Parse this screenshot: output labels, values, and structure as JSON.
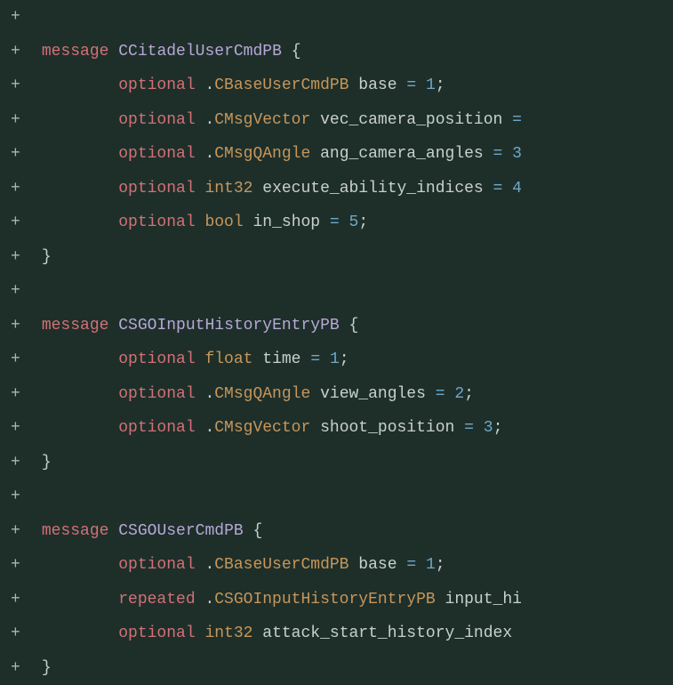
{
  "lines": [
    {
      "marker": "+",
      "tokens": []
    },
    {
      "marker": "+",
      "tokens": [
        {
          "cls": "indent",
          "t": " "
        },
        {
          "cls": "kw-message",
          "t": "message"
        },
        {
          "cls": "ident",
          "t": " "
        },
        {
          "cls": "msg-name",
          "t": "CCitadelUserCmdPB"
        },
        {
          "cls": "ident",
          "t": " "
        },
        {
          "cls": "brace",
          "t": "{"
        }
      ]
    },
    {
      "marker": "+",
      "tokens": [
        {
          "cls": "indent",
          "t": "         "
        },
        {
          "cls": "kw-optional",
          "t": "optional"
        },
        {
          "cls": "ident",
          "t": " ."
        },
        {
          "cls": "type-user",
          "t": "CBaseUserCmdPB"
        },
        {
          "cls": "ident",
          "t": " "
        },
        {
          "cls": "field",
          "t": "base"
        },
        {
          "cls": "ident",
          "t": " "
        },
        {
          "cls": "op",
          "t": "="
        },
        {
          "cls": "ident",
          "t": " "
        },
        {
          "cls": "num",
          "t": "1"
        },
        {
          "cls": "punct",
          "t": ";"
        }
      ]
    },
    {
      "marker": "+",
      "tokens": [
        {
          "cls": "indent",
          "t": "         "
        },
        {
          "cls": "kw-optional",
          "t": "optional"
        },
        {
          "cls": "ident",
          "t": " ."
        },
        {
          "cls": "type-user",
          "t": "CMsgVector"
        },
        {
          "cls": "ident",
          "t": " "
        },
        {
          "cls": "field",
          "t": "vec_camera_position"
        },
        {
          "cls": "ident",
          "t": " "
        },
        {
          "cls": "op",
          "t": "="
        }
      ]
    },
    {
      "marker": "+",
      "tokens": [
        {
          "cls": "indent",
          "t": "         "
        },
        {
          "cls": "kw-optional",
          "t": "optional"
        },
        {
          "cls": "ident",
          "t": " ."
        },
        {
          "cls": "type-user",
          "t": "CMsgQAngle"
        },
        {
          "cls": "ident",
          "t": " "
        },
        {
          "cls": "field",
          "t": "ang_camera_angles"
        },
        {
          "cls": "ident",
          "t": " "
        },
        {
          "cls": "op",
          "t": "="
        },
        {
          "cls": "ident",
          "t": " "
        },
        {
          "cls": "num",
          "t": "3"
        }
      ]
    },
    {
      "marker": "+",
      "tokens": [
        {
          "cls": "indent",
          "t": "         "
        },
        {
          "cls": "kw-optional",
          "t": "optional"
        },
        {
          "cls": "ident",
          "t": " "
        },
        {
          "cls": "type-builtin",
          "t": "int32"
        },
        {
          "cls": "ident",
          "t": " "
        },
        {
          "cls": "field",
          "t": "execute_ability_indices"
        },
        {
          "cls": "ident",
          "t": " "
        },
        {
          "cls": "op",
          "t": "="
        },
        {
          "cls": "ident",
          "t": " "
        },
        {
          "cls": "num",
          "t": "4"
        }
      ]
    },
    {
      "marker": "+",
      "tokens": [
        {
          "cls": "indent",
          "t": "         "
        },
        {
          "cls": "kw-optional",
          "t": "optional"
        },
        {
          "cls": "ident",
          "t": " "
        },
        {
          "cls": "type-builtin",
          "t": "bool"
        },
        {
          "cls": "ident",
          "t": " "
        },
        {
          "cls": "field",
          "t": "in_shop"
        },
        {
          "cls": "ident",
          "t": " "
        },
        {
          "cls": "op",
          "t": "="
        },
        {
          "cls": "ident",
          "t": " "
        },
        {
          "cls": "num",
          "t": "5"
        },
        {
          "cls": "punct",
          "t": ";"
        }
      ]
    },
    {
      "marker": "+",
      "tokens": [
        {
          "cls": "indent",
          "t": " "
        },
        {
          "cls": "brace",
          "t": "}"
        }
      ]
    },
    {
      "marker": "+",
      "tokens": []
    },
    {
      "marker": "+",
      "tokens": [
        {
          "cls": "indent",
          "t": " "
        },
        {
          "cls": "kw-message",
          "t": "message"
        },
        {
          "cls": "ident",
          "t": " "
        },
        {
          "cls": "msg-name",
          "t": "CSGOInputHistoryEntryPB"
        },
        {
          "cls": "ident",
          "t": " "
        },
        {
          "cls": "brace",
          "t": "{"
        }
      ]
    },
    {
      "marker": "+",
      "tokens": [
        {
          "cls": "indent",
          "t": "         "
        },
        {
          "cls": "kw-optional",
          "t": "optional"
        },
        {
          "cls": "ident",
          "t": " "
        },
        {
          "cls": "type-builtin",
          "t": "float"
        },
        {
          "cls": "ident",
          "t": " "
        },
        {
          "cls": "field",
          "t": "time"
        },
        {
          "cls": "ident",
          "t": " "
        },
        {
          "cls": "op",
          "t": "="
        },
        {
          "cls": "ident",
          "t": " "
        },
        {
          "cls": "num",
          "t": "1"
        },
        {
          "cls": "punct",
          "t": ";"
        }
      ]
    },
    {
      "marker": "+",
      "tokens": [
        {
          "cls": "indent",
          "t": "         "
        },
        {
          "cls": "kw-optional",
          "t": "optional"
        },
        {
          "cls": "ident",
          "t": " ."
        },
        {
          "cls": "type-user",
          "t": "CMsgQAngle"
        },
        {
          "cls": "ident",
          "t": " "
        },
        {
          "cls": "field",
          "t": "view_angles"
        },
        {
          "cls": "ident",
          "t": " "
        },
        {
          "cls": "op",
          "t": "="
        },
        {
          "cls": "ident",
          "t": " "
        },
        {
          "cls": "num",
          "t": "2"
        },
        {
          "cls": "punct",
          "t": ";"
        }
      ]
    },
    {
      "marker": "+",
      "tokens": [
        {
          "cls": "indent",
          "t": "         "
        },
        {
          "cls": "kw-optional",
          "t": "optional"
        },
        {
          "cls": "ident",
          "t": " ."
        },
        {
          "cls": "type-user",
          "t": "CMsgVector"
        },
        {
          "cls": "ident",
          "t": " "
        },
        {
          "cls": "field",
          "t": "shoot_position"
        },
        {
          "cls": "ident",
          "t": " "
        },
        {
          "cls": "op",
          "t": "="
        },
        {
          "cls": "ident",
          "t": " "
        },
        {
          "cls": "num",
          "t": "3"
        },
        {
          "cls": "punct",
          "t": ";"
        }
      ]
    },
    {
      "marker": "+",
      "tokens": [
        {
          "cls": "indent",
          "t": " "
        },
        {
          "cls": "brace",
          "t": "}"
        }
      ]
    },
    {
      "marker": "+",
      "tokens": []
    },
    {
      "marker": "+",
      "tokens": [
        {
          "cls": "indent",
          "t": " "
        },
        {
          "cls": "kw-message",
          "t": "message"
        },
        {
          "cls": "ident",
          "t": " "
        },
        {
          "cls": "msg-name",
          "t": "CSGOUserCmdPB"
        },
        {
          "cls": "ident",
          "t": " "
        },
        {
          "cls": "brace",
          "t": "{"
        }
      ]
    },
    {
      "marker": "+",
      "tokens": [
        {
          "cls": "indent",
          "t": "         "
        },
        {
          "cls": "kw-optional",
          "t": "optional"
        },
        {
          "cls": "ident",
          "t": " ."
        },
        {
          "cls": "type-user",
          "t": "CBaseUserCmdPB"
        },
        {
          "cls": "ident",
          "t": " "
        },
        {
          "cls": "field",
          "t": "base"
        },
        {
          "cls": "ident",
          "t": " "
        },
        {
          "cls": "op",
          "t": "="
        },
        {
          "cls": "ident",
          "t": " "
        },
        {
          "cls": "num",
          "t": "1"
        },
        {
          "cls": "punct",
          "t": ";"
        }
      ]
    },
    {
      "marker": "+",
      "tokens": [
        {
          "cls": "indent",
          "t": "         "
        },
        {
          "cls": "kw-repeated",
          "t": "repeated"
        },
        {
          "cls": "ident",
          "t": " ."
        },
        {
          "cls": "type-user",
          "t": "CSGOInputHistoryEntryPB"
        },
        {
          "cls": "ident",
          "t": " "
        },
        {
          "cls": "field",
          "t": "input_hi"
        }
      ]
    },
    {
      "marker": "+",
      "tokens": [
        {
          "cls": "indent",
          "t": "         "
        },
        {
          "cls": "kw-optional",
          "t": "optional"
        },
        {
          "cls": "ident",
          "t": " "
        },
        {
          "cls": "type-builtin",
          "t": "int32"
        },
        {
          "cls": "ident",
          "t": " "
        },
        {
          "cls": "field",
          "t": "attack_start_history_index"
        }
      ]
    },
    {
      "marker": "+",
      "tokens": [
        {
          "cls": "indent",
          "t": " "
        },
        {
          "cls": "brace",
          "t": "}"
        }
      ]
    }
  ]
}
